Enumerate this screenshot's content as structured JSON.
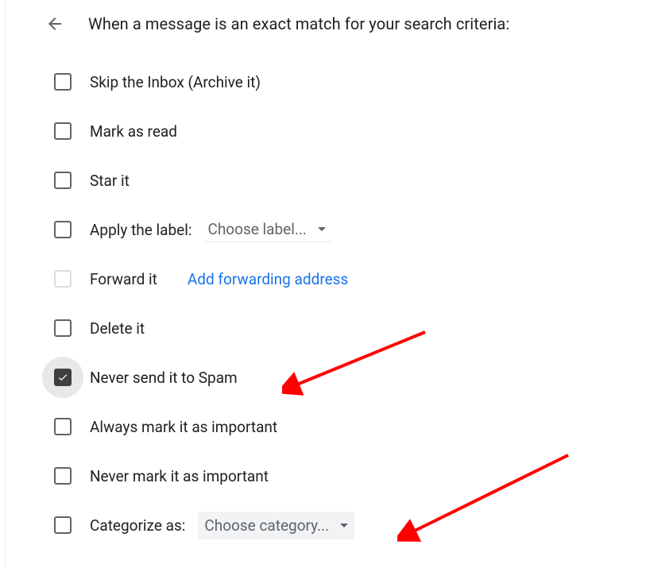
{
  "header": {
    "title": "When a message is an exact match for your search criteria:"
  },
  "options": {
    "skip_inbox": "Skip the Inbox (Archive it)",
    "mark_read": "Mark as read",
    "star_it": "Star it",
    "apply_label": "Apply the label:",
    "apply_label_placeholder": "Choose label...",
    "forward_it": "Forward it",
    "add_forwarding": "Add forwarding address",
    "delete_it": "Delete it",
    "never_spam": "Never send it to Spam",
    "always_important": "Always mark it as important",
    "never_important": "Never mark it as important",
    "categorize_as": "Categorize as:",
    "categorize_placeholder": "Choose category..."
  }
}
